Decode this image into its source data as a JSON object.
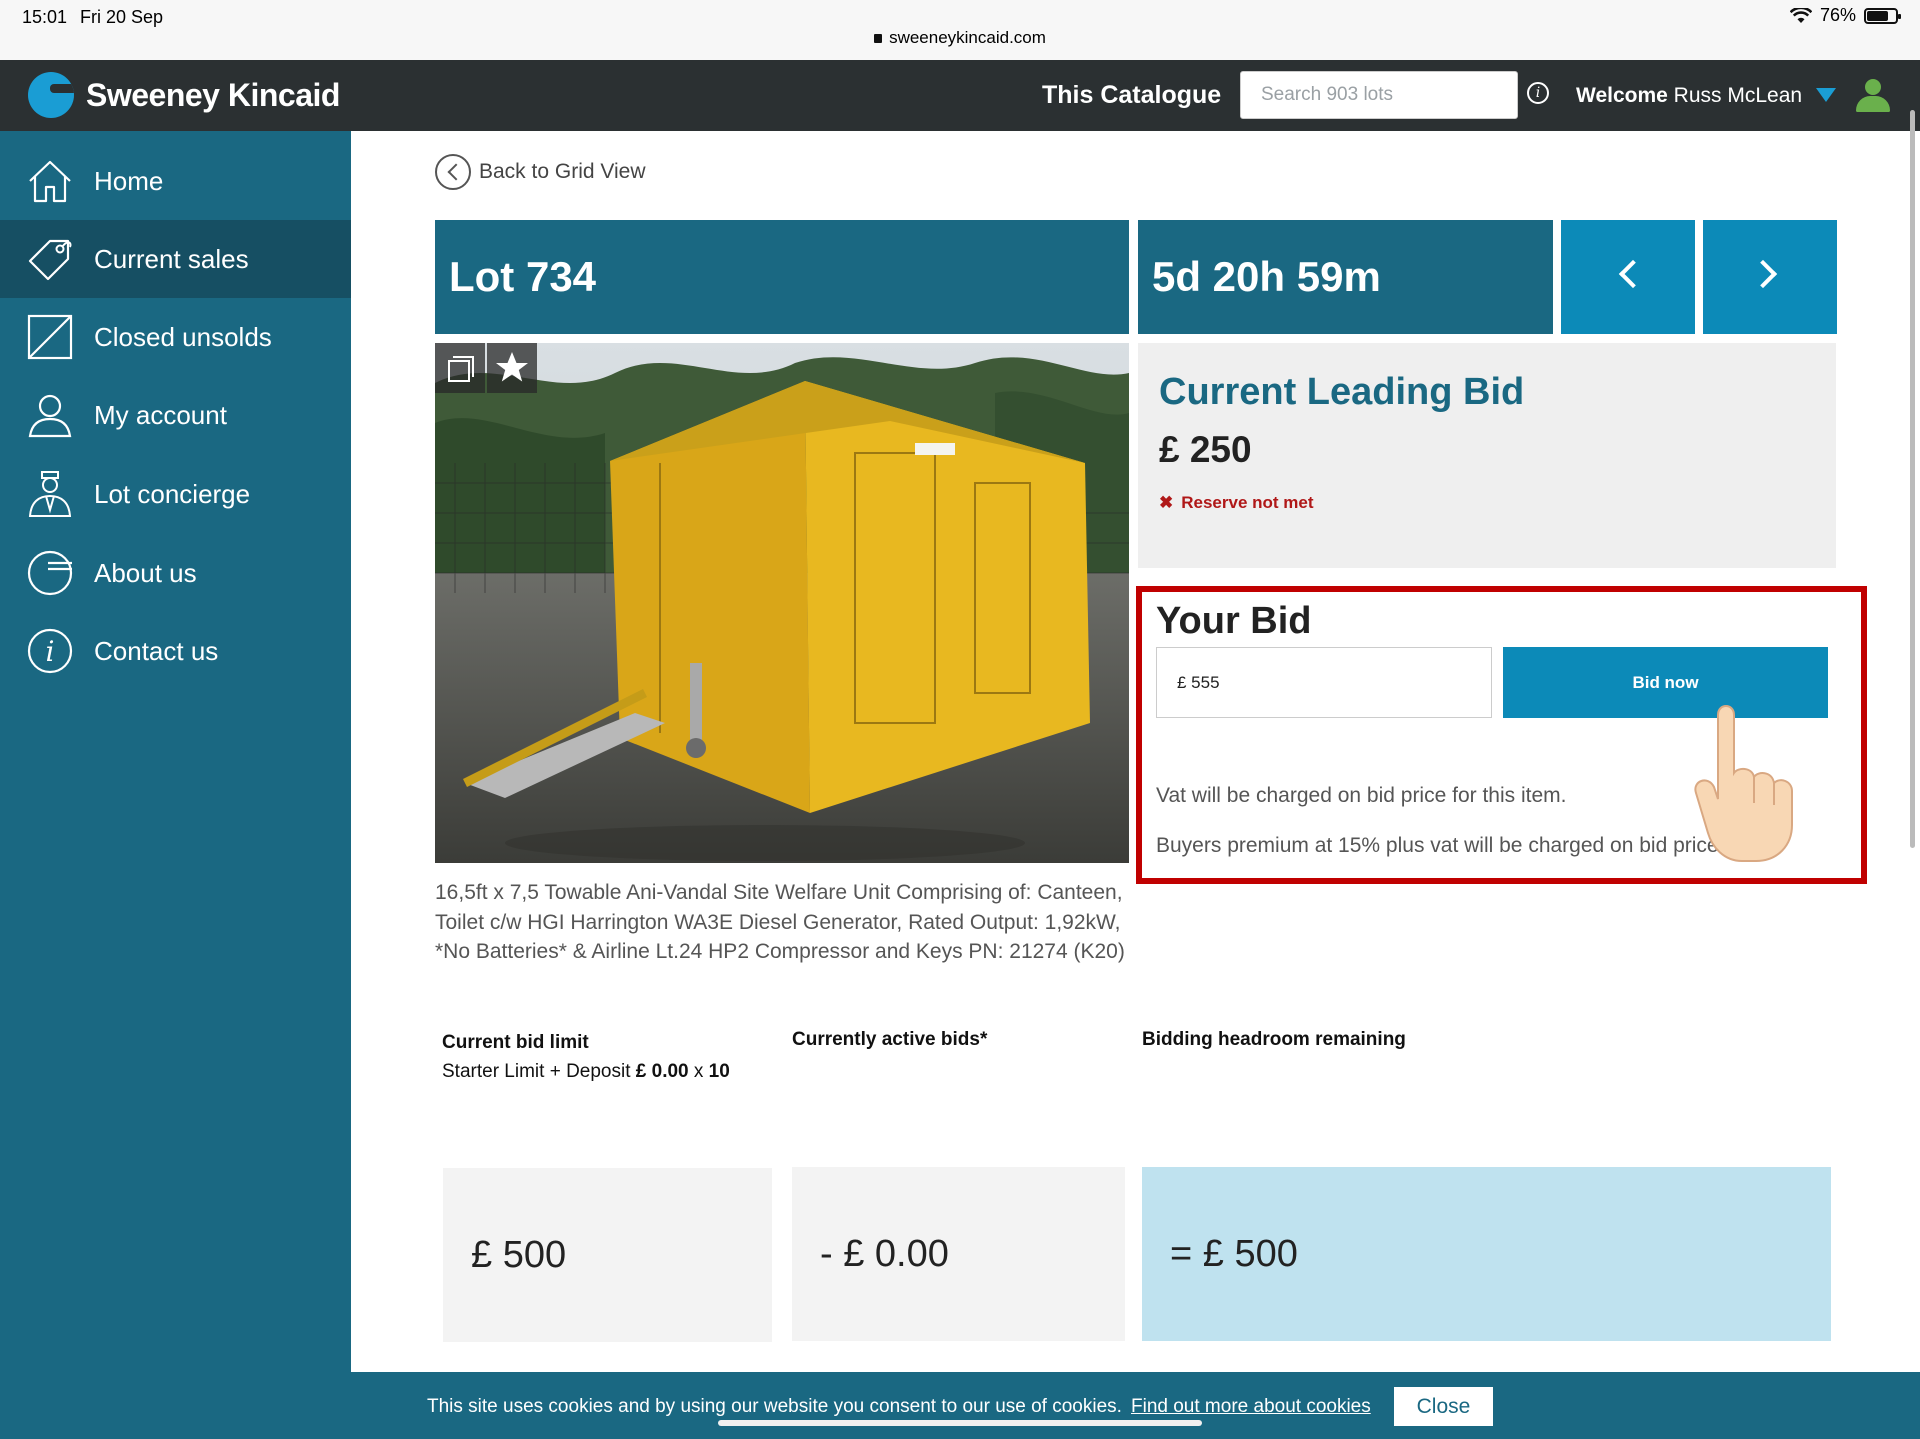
{
  "status_bar": {
    "time": "15:01",
    "date": "Fri 20 Sep",
    "url": "sweeneykincaid.com",
    "battery": "76%",
    "battery_level": 0.76
  },
  "header": {
    "brand": "Sweeney Kincaid",
    "catalogue_label": "This Catalogue",
    "search_placeholder": "Search 903 lots",
    "welcome_label": "Welcome",
    "user_name": "Russ McLean"
  },
  "sidebar": {
    "items": [
      {
        "label": "Home",
        "icon": "home-icon"
      },
      {
        "label": "Current sales",
        "icon": "tag-icon"
      },
      {
        "label": "Closed unsolds",
        "icon": "closed-icon"
      },
      {
        "label": "My account",
        "icon": "user-icon"
      },
      {
        "label": "Lot concierge",
        "icon": "concierge-icon"
      },
      {
        "label": "About us",
        "icon": "logo-icon"
      },
      {
        "label": "Contact us",
        "icon": "info-icon"
      }
    ],
    "active_index": 1
  },
  "main": {
    "back_label": "Back to Grid View",
    "lot_title": "Lot 734",
    "countdown": "5d 20h 59m",
    "description": "16,5ft x 7,5 Towable Ani-Vandal Site Welfare Unit Comprising of: Canteen, Toilet c/w HGI Harrington WA3E Diesel Generator, Rated Output: 1,92kW, *No Batteries* & Airline Lt.24 HP2 Compressor and Keys PN: 21274 (K20)",
    "leading_bid": {
      "heading": "Current Leading Bid",
      "amount": "£ 250",
      "reserve_status": "Reserve not met"
    },
    "your_bid": {
      "heading": "Your Bid",
      "input_value": "£ 555",
      "button_label": "Bid now",
      "vat_note": "Vat will be charged on bid price for this item.",
      "premium_note": "Buyers premium at 15% plus vat will be charged on bid price."
    },
    "limits": {
      "current_bid_limit_label": "Current bid limit",
      "starter_text": "Starter Limit + Deposit",
      "starter_amount": "£ 0.00",
      "times": "x",
      "multiplier": "10",
      "active_bids_label": "Currently active bids*",
      "headroom_label": "Bidding headroom remaining",
      "limit_value": "£ 500",
      "active_value": "- £ 0.00",
      "headroom_value": "= £ 500"
    }
  },
  "cookie": {
    "text": "This site uses cookies and by using our website you consent to our use of cookies.",
    "link": "Find out more about cookies",
    "close": "Close"
  },
  "colors": {
    "teal": "#1a6882",
    "teal_dark": "#164f63",
    "blue": "#0c8ab8",
    "header_bg": "#2b3032",
    "reserve_red": "#b01818",
    "highlight_red": "#c00000",
    "headroom_bg": "#bfe2ef"
  }
}
